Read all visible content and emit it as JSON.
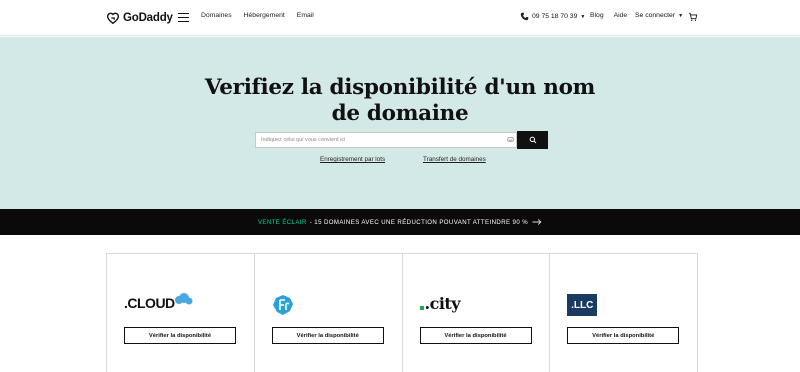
{
  "header": {
    "brand": "GoDaddy",
    "nav": [
      "Domaines",
      "Hébergement",
      "Email"
    ],
    "phone": "09 75 18 70 39",
    "links": [
      "Blog",
      "Aide"
    ],
    "signin": "Se connecter"
  },
  "hero": {
    "title": "Verifiez la disponibilité d'un nom de domaine",
    "search_placeholder": "Indiquez celui qui vous convient ici",
    "link_bulk": "Enregistrement par lots",
    "link_transfer": "Transfert de domaines"
  },
  "promo": {
    "accent": "VENTE ÉCLAIR",
    "text": "- 15 DOMAINES AVEC UNE RÉDUCTION POUVANT ATTEINDRE 90 %"
  },
  "cards": [
    {
      "tld": ".CLOUD",
      "button": "Vérifier la disponibilité",
      "icon": "cloud-tld-logo"
    },
    {
      "tld": ".fr",
      "button": "Vérifier la disponibilité",
      "icon": "fr-tld-logo"
    },
    {
      "tld": ".city",
      "button": "Vérifier la disponibilité",
      "icon": "city-tld-logo"
    },
    {
      "tld": ".LLC",
      "button": "Vérifier la disponibilité",
      "icon": "llc-tld-logo"
    }
  ],
  "colors": {
    "hero_bg": "#d3e9e8",
    "promo_bg": "#0a0a0a",
    "promo_accent": "#00d1a1",
    "llc_blue": "#1b3a62",
    "cloud_blue": "#4aa8e0",
    "fr_blue": "#2aa2d8",
    "city_green": "#1ea85a"
  }
}
